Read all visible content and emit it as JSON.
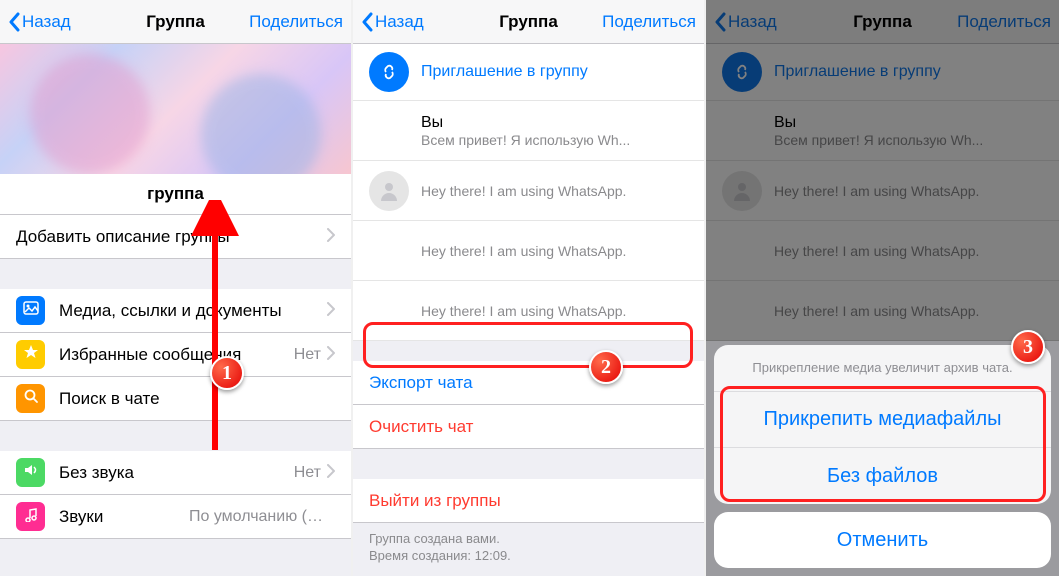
{
  "nav": {
    "back": "Назад",
    "title": "Группа",
    "share": "Поделиться"
  },
  "screen1": {
    "group_name": "группа",
    "add_desc": "Добавить описание группы",
    "rows": {
      "media": "Медиа, ссылки и документы",
      "favorites": "Избранные сообщения",
      "favorites_val": "Нет",
      "search": "Поиск в чате",
      "mute": "Без звука",
      "mute_val": "Нет",
      "sound": "Звуки",
      "sound_val": "По умолчанию (Нот..."
    }
  },
  "screen2": {
    "invite": "Приглашение в группу",
    "you": "Вы",
    "you_status": "Всем привет! Я использую Wh...",
    "p_status": "Hey there! I am using WhatsApp.",
    "export": "Экспорт чата",
    "clear": "Очистить чат",
    "leave": "Выйти из группы",
    "footer1": "Группа создана вами.",
    "footer2": "Время создания: 12:09."
  },
  "screen3": {
    "sheet_note": "Прикрепление медиа увеличит архив чата.",
    "attach": "Прикрепить медиафайлы",
    "without": "Без файлов",
    "cancel": "Отменить"
  },
  "badges": {
    "b1": "1",
    "b2": "2",
    "b3": "3"
  }
}
